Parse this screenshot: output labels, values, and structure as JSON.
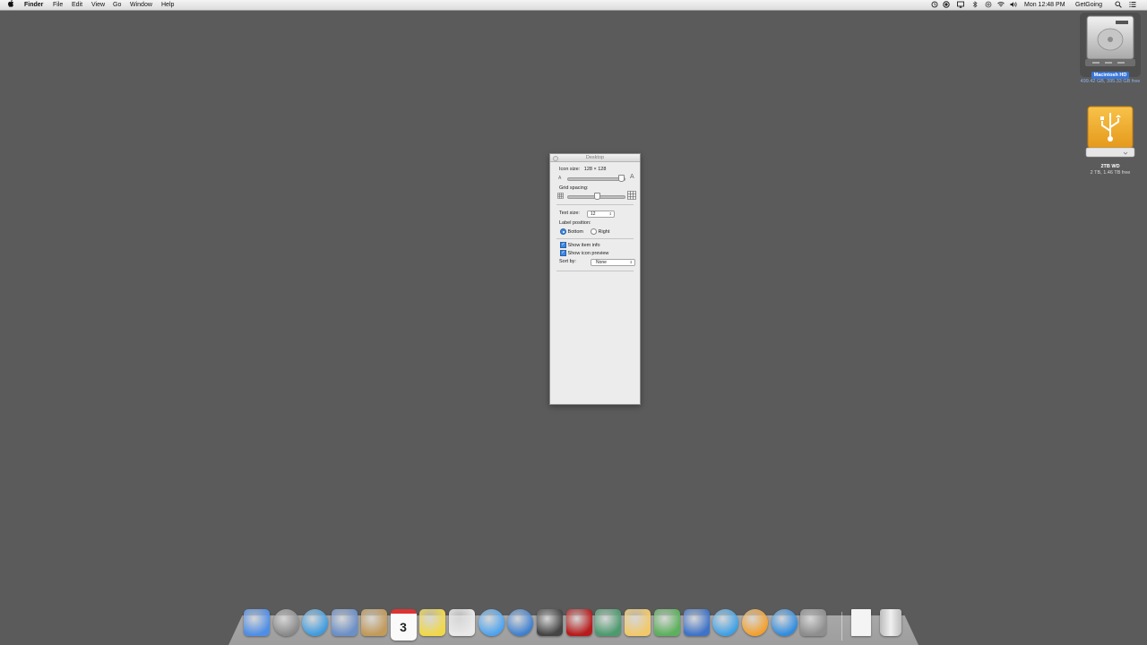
{
  "menubar": {
    "apple": "",
    "app_name": "Finder",
    "menus": [
      "File",
      "Edit",
      "View",
      "Go",
      "Window",
      "Help"
    ],
    "clock": "Mon 12:48 PM",
    "user": "GetGoing",
    "status_icons": [
      "time-machine-icon",
      "record-icon",
      "airplay-icon",
      "bluetooth-icon",
      "wifi-icon",
      "volume-icon"
    ]
  },
  "desktop": {
    "disks": [
      {
        "name": "Macintosh HD",
        "info": "499.42 GB, 395.33 GB free",
        "icon": "hard-disk-icon"
      },
      {
        "name": "2TB WD",
        "info": "2 TB, 1.46 TB free",
        "icon": "usb-drive-icon"
      }
    ]
  },
  "panel": {
    "title": "Desktop",
    "icon_size_label": "Icon size:",
    "icon_size_value": "128 × 128",
    "grid_spacing_label": "Grid spacing:",
    "text_size_label": "Text size:",
    "text_size_value": "12",
    "label_position_label": "Label position:",
    "label_bottom": "Bottom",
    "label_right": "Right",
    "show_item_info": "Show item info",
    "show_icon_preview": "Show icon preview",
    "sort_by_label": "Sort by:",
    "sort_by_value": "None"
  },
  "dock": {
    "items": [
      {
        "name": "finder",
        "color": "#4f8ee6"
      },
      {
        "name": "launchpad",
        "color": "#8a8a8a"
      },
      {
        "name": "safari",
        "color": "#3d9be0"
      },
      {
        "name": "mail",
        "color": "#6b8fc7"
      },
      {
        "name": "contacts",
        "color": "#c29a5a"
      },
      {
        "name": "calendar",
        "color": "#f3f3f3"
      },
      {
        "name": "notes",
        "color": "#f0d84a"
      },
      {
        "name": "reminders",
        "color": "#e9e9e9"
      },
      {
        "name": "messages",
        "color": "#4ca3f0"
      },
      {
        "name": "facetime",
        "color": "#3c7fd0"
      },
      {
        "name": "photo-booth",
        "color": "#444444"
      },
      {
        "name": "photo-booth-red",
        "color": "#b71c1c"
      },
      {
        "name": "iphoto",
        "color": "#4c9a6e"
      },
      {
        "name": "pages",
        "color": "#f2c96a"
      },
      {
        "name": "numbers",
        "color": "#5db05d"
      },
      {
        "name": "keynote",
        "color": "#3f73c8"
      },
      {
        "name": "itunes",
        "color": "#3da0e6"
      },
      {
        "name": "ibooks",
        "color": "#f4a02c"
      },
      {
        "name": "app-store",
        "color": "#2f8ce0"
      },
      {
        "name": "system-preferences",
        "color": "#8e8e8e"
      }
    ],
    "trailing": [
      {
        "name": "document",
        "color": "#f4f4f4"
      },
      {
        "name": "trash",
        "color": "#cfcfcf"
      }
    ]
  }
}
